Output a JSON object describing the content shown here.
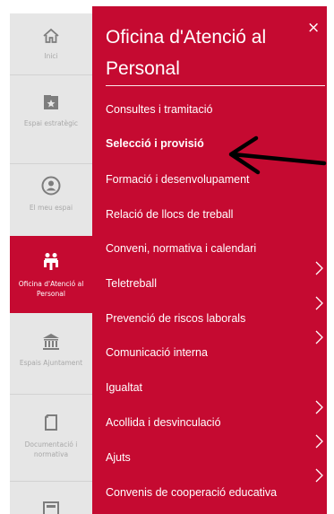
{
  "rail": {
    "items": [
      {
        "label": "Inici",
        "icon": "home-icon"
      },
      {
        "label": "Espai estratègic",
        "icon": "star-folder-icon"
      },
      {
        "label": "El meu espai",
        "icon": "user-circle-icon"
      },
      {
        "label": "Oficina d'Atenció al Personal",
        "icon": "office-people-icon"
      },
      {
        "label": "Espais Ajuntament",
        "icon": "building-columns-icon"
      },
      {
        "label": "Documentació i normativa",
        "icon": "document-icon"
      }
    ]
  },
  "panel": {
    "title": "Oficina d'Atenció al Personal",
    "close_label": "×",
    "menu": [
      {
        "label": "Consultes i tramitació",
        "bold": false,
        "has_submenu": false
      },
      {
        "label": "Selecció i provisió",
        "bold": true,
        "has_submenu": false
      },
      {
        "label": "Formació i desenvolupament",
        "bold": false,
        "has_submenu": true
      },
      {
        "label": "Relació de llocs de treball",
        "bold": false,
        "has_submenu": true
      },
      {
        "label": "Conveni, normativa i calendari",
        "bold": false,
        "has_submenu": true
      },
      {
        "label": "Teletreball",
        "bold": false,
        "has_submenu": false
      },
      {
        "label": "Prevenció de riscos laborals",
        "bold": false,
        "has_submenu": true
      },
      {
        "label": "Comunicació interna",
        "bold": false,
        "has_submenu": true
      },
      {
        "label": "Igualtat",
        "bold": false,
        "has_submenu": true
      },
      {
        "label": "Acollida i desvinculació",
        "bold": false,
        "has_submenu": false
      },
      {
        "label": "Ajuts",
        "bold": false,
        "has_submenu": false
      },
      {
        "label": "Convenis de cooperació educativa",
        "bold": false,
        "has_submenu": false
      }
    ]
  },
  "colors": {
    "accent": "#c50a31",
    "rail_bg": "#e6e6e6"
  }
}
